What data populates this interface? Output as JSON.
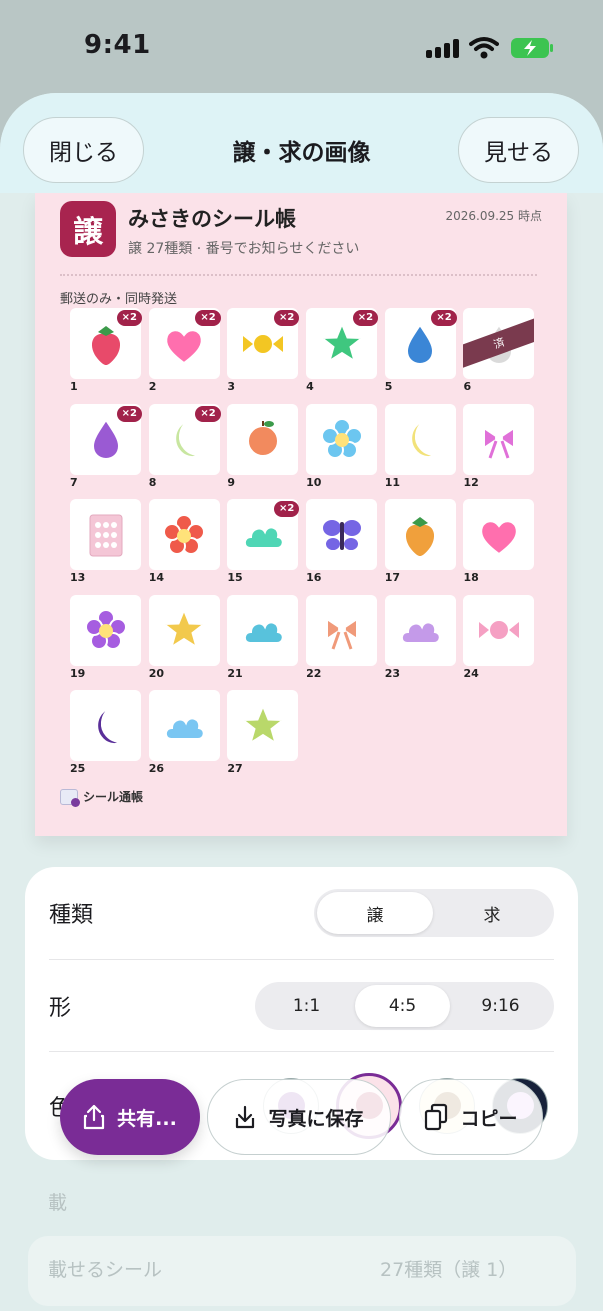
{
  "status_bar": {
    "time": "9:41"
  },
  "topbar": {
    "close_label": "閉じる",
    "title": "譲・求の画像",
    "show_label": "見せる"
  },
  "card": {
    "badge": "譲",
    "name": "みさきのシール帳",
    "date": "2026.09.25 時点",
    "subtitle": "譲 27種類 · 番号でお知らせください",
    "note": "郵送のみ・同時発送",
    "logo_text": "シール通帳",
    "done_label": "済",
    "stickers": [
      {
        "num": "1",
        "qty": "×2",
        "icon": "strawberry-icon"
      },
      {
        "num": "2",
        "qty": "×2",
        "icon": "heart-icon"
      },
      {
        "num": "3",
        "qty": "×2",
        "icon": "candy-icon"
      },
      {
        "num": "4",
        "qty": "×2",
        "icon": "star-icon"
      },
      {
        "num": "5",
        "qty": "×2",
        "icon": "droplet-icon"
      },
      {
        "num": "6",
        "qty": "",
        "icon": "droplet-icon",
        "done": true
      },
      {
        "num": "7",
        "qty": "×2",
        "icon": "droplet-icon"
      },
      {
        "num": "8",
        "qty": "×2",
        "icon": "moon-icon"
      },
      {
        "num": "9",
        "qty": "",
        "icon": "peach-icon"
      },
      {
        "num": "10",
        "qty": "",
        "icon": "flower-icon"
      },
      {
        "num": "11",
        "qty": "",
        "icon": "moon-icon"
      },
      {
        "num": "12",
        "qty": "",
        "icon": "ribbon-icon"
      },
      {
        "num": "13",
        "qty": "",
        "icon": "sticker-sheet-icon"
      },
      {
        "num": "14",
        "qty": "",
        "icon": "flower-icon"
      },
      {
        "num": "15",
        "qty": "×2",
        "icon": "cloud-icon"
      },
      {
        "num": "16",
        "qty": "",
        "icon": "butterfly-icon"
      },
      {
        "num": "17",
        "qty": "",
        "icon": "strawberry-icon"
      },
      {
        "num": "18",
        "qty": "",
        "icon": "heart-icon"
      },
      {
        "num": "19",
        "qty": "",
        "icon": "flower-icon"
      },
      {
        "num": "20",
        "qty": "",
        "icon": "star-icon"
      },
      {
        "num": "21",
        "qty": "",
        "icon": "cloud-icon"
      },
      {
        "num": "22",
        "qty": "",
        "icon": "ribbon-icon"
      },
      {
        "num": "23",
        "qty": "",
        "icon": "cloud-icon"
      },
      {
        "num": "24",
        "qty": "",
        "icon": "candy-icon"
      },
      {
        "num": "25",
        "qty": "",
        "icon": "moon-icon"
      },
      {
        "num": "26",
        "qty": "",
        "icon": "cloud-icon"
      },
      {
        "num": "27",
        "qty": "",
        "icon": "star-icon"
      }
    ]
  },
  "options": {
    "type_label": "種類",
    "type_options": [
      "譲",
      "求"
    ],
    "type_selected": "譲",
    "shape_label": "形",
    "shape_options": [
      "1:1",
      "4:5",
      "9:16"
    ],
    "shape_selected": "4:5",
    "color_label": "色",
    "colors": [
      {
        "name": "purple",
        "inner": "#7b35a0",
        "outer": "#ffffff",
        "selected": false
      },
      {
        "name": "raspberry",
        "inner": "#a8244f",
        "outer": "#fbe2e9",
        "selected": true
      },
      {
        "name": "brown",
        "inner": "#7a4a0d",
        "outer": "#fdf1c8",
        "selected": false
      },
      {
        "name": "lavender",
        "inner": "#d8aef6",
        "outer": "#17213a",
        "selected": false
      }
    ]
  },
  "actions": {
    "share_label": "共有...",
    "save_label": "写真に保存",
    "copy_label": "コピー"
  },
  "background": {
    "section_label": "載",
    "row_label": "載せるシール",
    "row_value": "27種類（譲 1）"
  },
  "colors": {
    "accent": "#7a2c96",
    "badge": "#a8244f",
    "card_bg": "#fbe2e9"
  }
}
